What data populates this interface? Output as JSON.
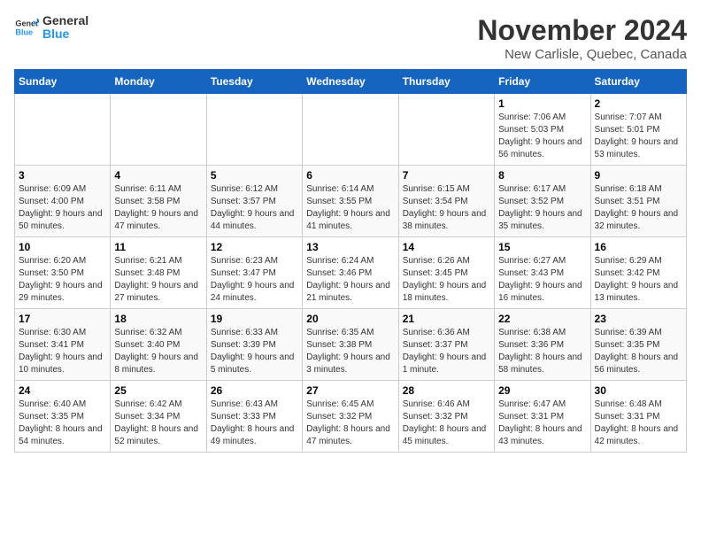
{
  "logo": {
    "line1": "General",
    "line2": "Blue"
  },
  "title": "November 2024",
  "subtitle": "New Carlisle, Quebec, Canada",
  "days_of_week": [
    "Sunday",
    "Monday",
    "Tuesday",
    "Wednesday",
    "Thursday",
    "Friday",
    "Saturday"
  ],
  "weeks": [
    [
      {
        "day": "",
        "info": ""
      },
      {
        "day": "",
        "info": ""
      },
      {
        "day": "",
        "info": ""
      },
      {
        "day": "",
        "info": ""
      },
      {
        "day": "",
        "info": ""
      },
      {
        "day": "1",
        "info": "Sunrise: 7:06 AM\nSunset: 5:03 PM\nDaylight: 9 hours and 56 minutes."
      },
      {
        "day": "2",
        "info": "Sunrise: 7:07 AM\nSunset: 5:01 PM\nDaylight: 9 hours and 53 minutes."
      }
    ],
    [
      {
        "day": "3",
        "info": "Sunrise: 6:09 AM\nSunset: 4:00 PM\nDaylight: 9 hours and 50 minutes."
      },
      {
        "day": "4",
        "info": "Sunrise: 6:11 AM\nSunset: 3:58 PM\nDaylight: 9 hours and 47 minutes."
      },
      {
        "day": "5",
        "info": "Sunrise: 6:12 AM\nSunset: 3:57 PM\nDaylight: 9 hours and 44 minutes."
      },
      {
        "day": "6",
        "info": "Sunrise: 6:14 AM\nSunset: 3:55 PM\nDaylight: 9 hours and 41 minutes."
      },
      {
        "day": "7",
        "info": "Sunrise: 6:15 AM\nSunset: 3:54 PM\nDaylight: 9 hours and 38 minutes."
      },
      {
        "day": "8",
        "info": "Sunrise: 6:17 AM\nSunset: 3:52 PM\nDaylight: 9 hours and 35 minutes."
      },
      {
        "day": "9",
        "info": "Sunrise: 6:18 AM\nSunset: 3:51 PM\nDaylight: 9 hours and 32 minutes."
      }
    ],
    [
      {
        "day": "10",
        "info": "Sunrise: 6:20 AM\nSunset: 3:50 PM\nDaylight: 9 hours and 29 minutes."
      },
      {
        "day": "11",
        "info": "Sunrise: 6:21 AM\nSunset: 3:48 PM\nDaylight: 9 hours and 27 minutes."
      },
      {
        "day": "12",
        "info": "Sunrise: 6:23 AM\nSunset: 3:47 PM\nDaylight: 9 hours and 24 minutes."
      },
      {
        "day": "13",
        "info": "Sunrise: 6:24 AM\nSunset: 3:46 PM\nDaylight: 9 hours and 21 minutes."
      },
      {
        "day": "14",
        "info": "Sunrise: 6:26 AM\nSunset: 3:45 PM\nDaylight: 9 hours and 18 minutes."
      },
      {
        "day": "15",
        "info": "Sunrise: 6:27 AM\nSunset: 3:43 PM\nDaylight: 9 hours and 16 minutes."
      },
      {
        "day": "16",
        "info": "Sunrise: 6:29 AM\nSunset: 3:42 PM\nDaylight: 9 hours and 13 minutes."
      }
    ],
    [
      {
        "day": "17",
        "info": "Sunrise: 6:30 AM\nSunset: 3:41 PM\nDaylight: 9 hours and 10 minutes."
      },
      {
        "day": "18",
        "info": "Sunrise: 6:32 AM\nSunset: 3:40 PM\nDaylight: 9 hours and 8 minutes."
      },
      {
        "day": "19",
        "info": "Sunrise: 6:33 AM\nSunset: 3:39 PM\nDaylight: 9 hours and 5 minutes."
      },
      {
        "day": "20",
        "info": "Sunrise: 6:35 AM\nSunset: 3:38 PM\nDaylight: 9 hours and 3 minutes."
      },
      {
        "day": "21",
        "info": "Sunrise: 6:36 AM\nSunset: 3:37 PM\nDaylight: 9 hours and 1 minute."
      },
      {
        "day": "22",
        "info": "Sunrise: 6:38 AM\nSunset: 3:36 PM\nDaylight: 8 hours and 58 minutes."
      },
      {
        "day": "23",
        "info": "Sunrise: 6:39 AM\nSunset: 3:35 PM\nDaylight: 8 hours and 56 minutes."
      }
    ],
    [
      {
        "day": "24",
        "info": "Sunrise: 6:40 AM\nSunset: 3:35 PM\nDaylight: 8 hours and 54 minutes."
      },
      {
        "day": "25",
        "info": "Sunrise: 6:42 AM\nSunset: 3:34 PM\nDaylight: 8 hours and 52 minutes."
      },
      {
        "day": "26",
        "info": "Sunrise: 6:43 AM\nSunset: 3:33 PM\nDaylight: 8 hours and 49 minutes."
      },
      {
        "day": "27",
        "info": "Sunrise: 6:45 AM\nSunset: 3:32 PM\nDaylight: 8 hours and 47 minutes."
      },
      {
        "day": "28",
        "info": "Sunrise: 6:46 AM\nSunset: 3:32 PM\nDaylight: 8 hours and 45 minutes."
      },
      {
        "day": "29",
        "info": "Sunrise: 6:47 AM\nSunset: 3:31 PM\nDaylight: 8 hours and 43 minutes."
      },
      {
        "day": "30",
        "info": "Sunrise: 6:48 AM\nSunset: 3:31 PM\nDaylight: 8 hours and 42 minutes."
      }
    ]
  ]
}
